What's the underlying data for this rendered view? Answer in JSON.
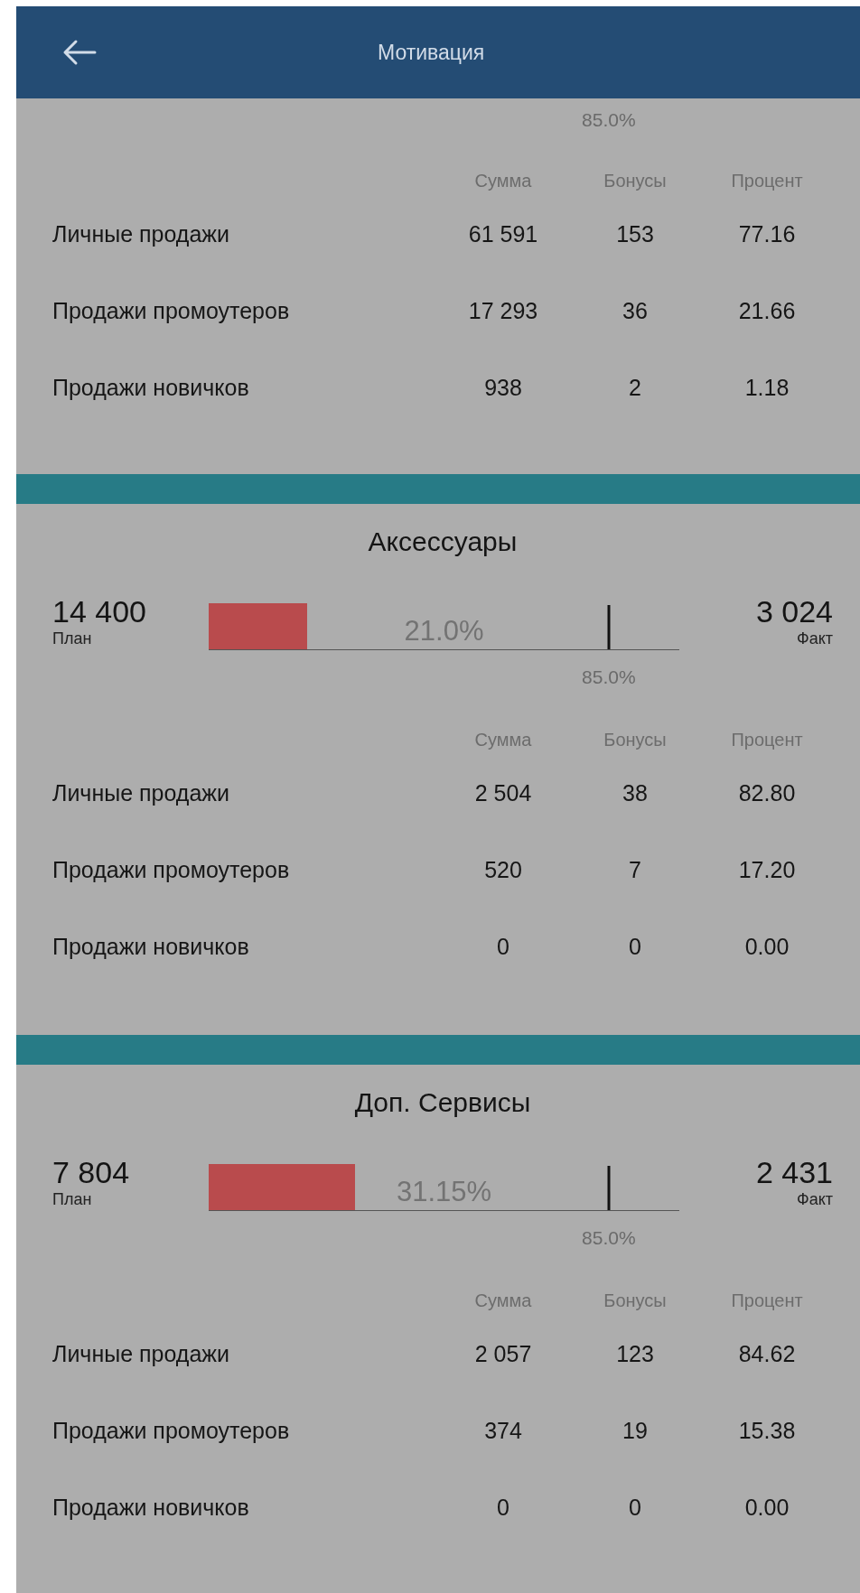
{
  "header": {
    "title": "Мотивация"
  },
  "sections": [
    {
      "target": {
        "label": "85.0%"
      },
      "columns": [
        "Сумма",
        "Бонусы",
        "Процент"
      ],
      "rows": [
        {
          "label": "Личные продажи",
          "cells": [
            "61 591",
            "153",
            "77.16"
          ]
        },
        {
          "label": "Продажи промоутеров",
          "cells": [
            "17 293",
            "36",
            "21.66"
          ]
        },
        {
          "label": "Продажи новичков",
          "cells": [
            "938",
            "2",
            "1.18"
          ]
        }
      ]
    },
    {
      "title": "Аксессуары",
      "plan": {
        "value": "14 400",
        "label": "План"
      },
      "fact": {
        "value": "3 024",
        "label": "Факт"
      },
      "progress": {
        "level": 0.21,
        "label": "21.0%"
      },
      "target": {
        "level": 0.85,
        "label": "85.0%"
      },
      "columns": [
        "Сумма",
        "Бонусы",
        "Процент"
      ],
      "rows": [
        {
          "label": "Личные продажи",
          "cells": [
            "2 504",
            "38",
            "82.80"
          ]
        },
        {
          "label": "Продажи промоутеров",
          "cells": [
            "520",
            "7",
            "17.20"
          ]
        },
        {
          "label": "Продажи новичков",
          "cells": [
            "0",
            "0",
            "0.00"
          ]
        }
      ]
    },
    {
      "title": "Доп. Сервисы",
      "plan": {
        "value": "7 804",
        "label": "План"
      },
      "fact": {
        "value": "2 431",
        "label": "Факт"
      },
      "progress": {
        "level": 0.3115,
        "label": "31.15%"
      },
      "target": {
        "level": 0.85,
        "label": "85.0%"
      },
      "columns": [
        "Сумма",
        "Бонусы",
        "Процент"
      ],
      "rows": [
        {
          "label": "Личные продажи",
          "cells": [
            "2 057",
            "123",
            "84.62"
          ]
        },
        {
          "label": "Продажи промоутеров",
          "cells": [
            "374",
            "19",
            "15.38"
          ]
        },
        {
          "label": "Продажи новичков",
          "cells": [
            "0",
            "0",
            "0.00"
          ]
        }
      ]
    }
  ]
}
